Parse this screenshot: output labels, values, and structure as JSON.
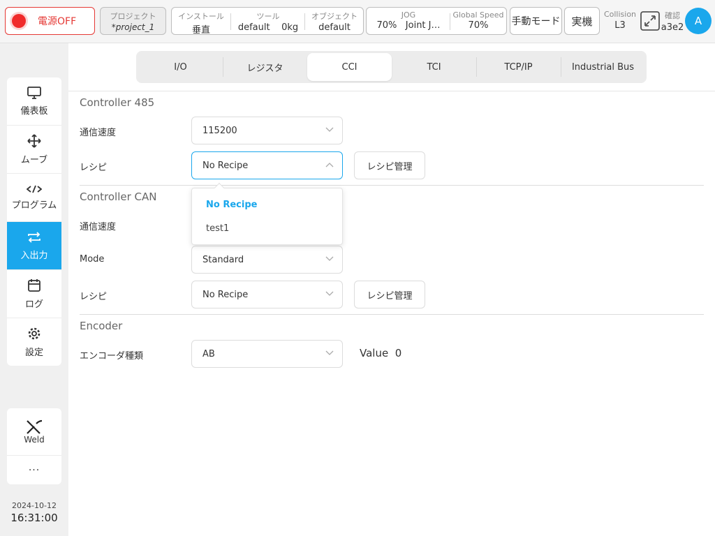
{
  "topbar": {
    "power_label": "電源OFF",
    "project_caption": "プロジェクト",
    "project_value": "*project_1",
    "install_caption": "インストール",
    "install_value": "垂直",
    "tool_caption": "ツール",
    "tool_value": "default",
    "tool_weight": "0kg",
    "object_caption": "オブジェクト",
    "object_value": "default",
    "jog_caption": "JOG",
    "jog_value": "70%",
    "jog_mode": "Joint J…",
    "speed_caption": "Global Speed",
    "speed_value": "70%",
    "mode_button": "手動モード",
    "real_button": "実機",
    "collision_caption": "Collision",
    "collision_value": "L3",
    "confirm_caption": "確認",
    "confirm_value": "a3e2",
    "avatar_letter": "A"
  },
  "sidebar": {
    "items": [
      {
        "label": "儀表板",
        "icon": "monitor-icon"
      },
      {
        "label": "ムーブ",
        "icon": "move-icon"
      },
      {
        "label": "プログラム",
        "icon": "code-icon"
      },
      {
        "label": "入出力",
        "icon": "io-icon"
      },
      {
        "label": "ログ",
        "icon": "calendar-icon"
      },
      {
        "label": "設定",
        "icon": "gear-icon"
      }
    ],
    "weld_label": "Weld",
    "more_label": "···",
    "date": "2024-10-12",
    "time": "16:31:00"
  },
  "tabs": [
    "I/O",
    "レジスタ",
    "CCI",
    "TCI",
    "TCP/IP",
    "Industrial Bus"
  ],
  "controller485": {
    "title": "Controller 485",
    "baud_label": "通信速度",
    "baud_value": "115200",
    "recipe_label": "レシピ",
    "recipe_value": "No Recipe",
    "recipe_button": "レシピ管理"
  },
  "dropdown": {
    "options": [
      "No Recipe",
      "test1"
    ],
    "selected": "No Recipe"
  },
  "controllerCAN": {
    "title": "Controller CAN",
    "baud_label": "通信速度",
    "mode_label": "Mode",
    "mode_value": "Standard",
    "recipe_label": "レシピ",
    "recipe_value": "No Recipe",
    "recipe_button": "レシピ管理"
  },
  "encoder": {
    "title": "Encoder",
    "type_label": "エンコーダ種類",
    "type_value": "AB",
    "value_label": "Value",
    "value": "0"
  },
  "colors": {
    "accent": "#1aa7ec",
    "power_red": "#e53935"
  }
}
